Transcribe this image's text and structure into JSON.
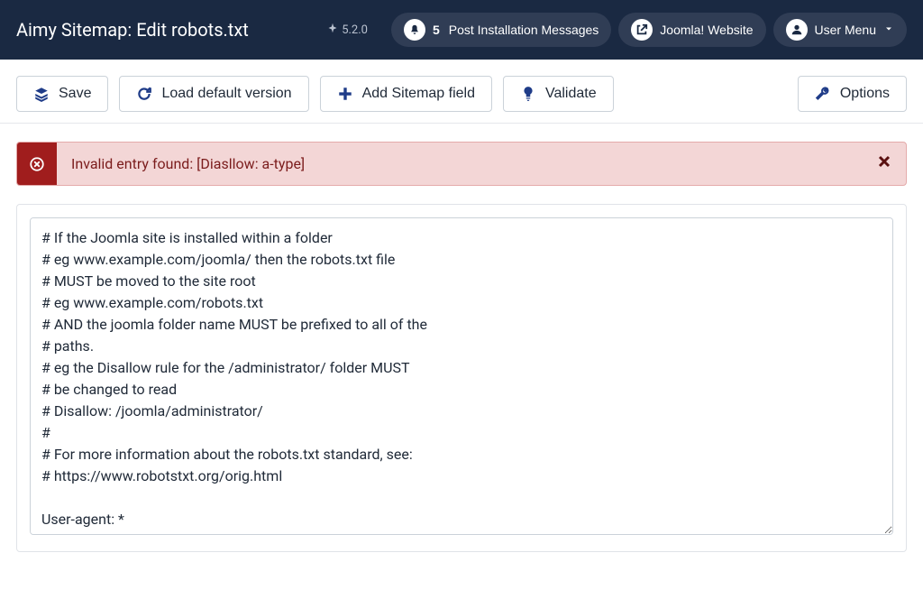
{
  "header": {
    "title": "Aimy Sitemap: Edit robots.txt",
    "version": "5.2.0",
    "notifications": {
      "count": "5",
      "label": "Post Installation Messages"
    },
    "website_label": "Joomla! Website",
    "user_menu_label": "User Menu"
  },
  "toolbar": {
    "save": "Save",
    "load_default": "Load default version",
    "add_sitemap": "Add Sitemap field",
    "validate": "Validate",
    "options": "Options"
  },
  "alert": {
    "message": "Invalid entry found: [Diasllow: a-type]"
  },
  "editor": {
    "value": "# If the Joomla site is installed within a folder\n# eg www.example.com/joomla/ then the robots.txt file\n# MUST be moved to the site root\n# eg www.example.com/robots.txt\n# AND the joomla folder name MUST be prefixed to all of the\n# paths.\n# eg the Disallow rule for the /administrator/ folder MUST\n# be changed to read\n# Disallow: /joomla/administrator/\n#\n# For more information about the robots.txt standard, see:\n# https://www.robotstxt.org/orig.html\n\nUser-agent: *\nDisallow: /administrator/"
  }
}
